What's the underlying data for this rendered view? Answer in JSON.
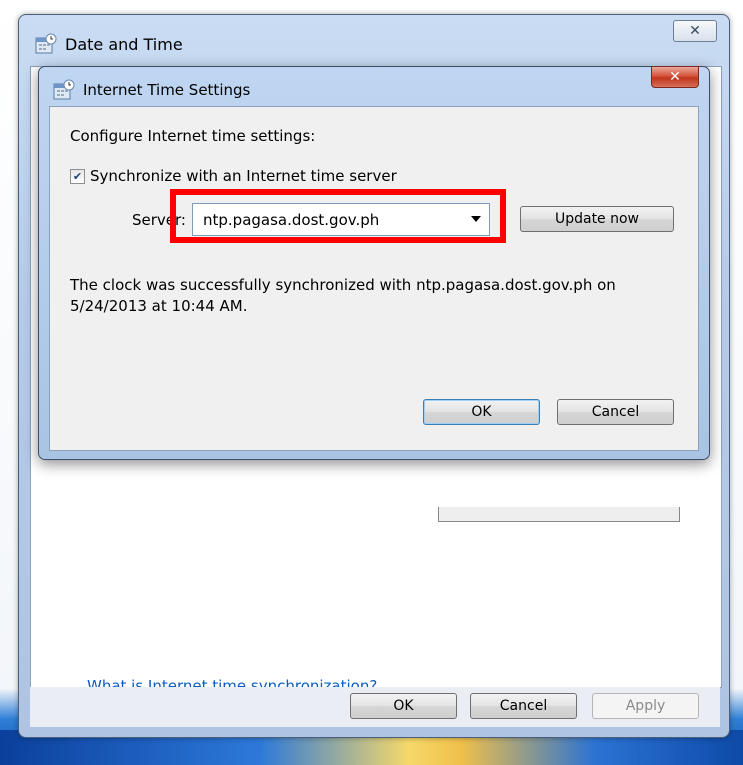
{
  "outer_window": {
    "title": "Date and Time",
    "close_glyph": "✕",
    "help_link": "What is Internet time synchronization?",
    "buttons": {
      "ok": "OK",
      "cancel": "Cancel",
      "apply": "Apply"
    }
  },
  "inner_dialog": {
    "title": "Internet Time Settings",
    "close_glyph": "✕",
    "configure_label": "Configure Internet time settings:",
    "sync_checkbox": {
      "label": "Synchronize with an Internet time server",
      "checked": true,
      "glyph": "✔"
    },
    "server_label": "Server:",
    "server_value": "ntp.pagasa.dost.gov.ph",
    "update_button": "Update now",
    "status_text": "The clock was successfully synchronized with ntp.pagasa.dost.gov.ph on 5/24/2013 at 10:44 AM.",
    "buttons": {
      "ok": "OK",
      "cancel": "Cancel"
    }
  },
  "colors": {
    "highlight": "#ff0000",
    "link": "#0a5bc4",
    "close_red": "#c2351d"
  },
  "icons": {
    "window_icon": "date-time-icon",
    "dropdown": "chevron-down-icon"
  }
}
